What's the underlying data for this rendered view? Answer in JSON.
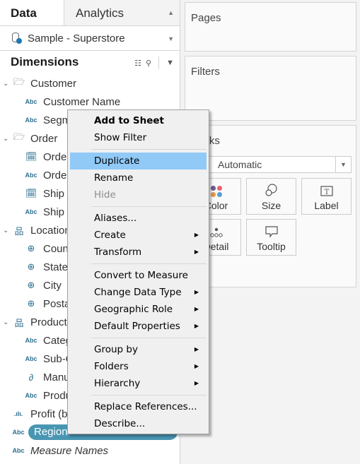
{
  "tabs": {
    "data": "Data",
    "analytics": "Analytics"
  },
  "data_source": "Sample - Superstore",
  "dimensions": {
    "title": "Dimensions",
    "tree": [
      {
        "type": "folder",
        "icon": "folder-icon",
        "label": "Customer"
      },
      {
        "type": "field",
        "icon": "abc-icon",
        "label": "Customer Name"
      },
      {
        "type": "field",
        "icon": "abc-icon",
        "label": "Segment"
      },
      {
        "type": "folder",
        "icon": "folder-icon",
        "label": "Order"
      },
      {
        "type": "field",
        "icon": "calendar-icon",
        "label": "Order Date"
      },
      {
        "type": "field",
        "icon": "abc-icon",
        "label": "Order ID"
      },
      {
        "type": "field",
        "icon": "calendar-icon",
        "label": "Ship Date"
      },
      {
        "type": "field",
        "icon": "abc-icon",
        "label": "Ship Mode"
      },
      {
        "type": "folder",
        "icon": "hierarchy-icon",
        "label": "Location"
      },
      {
        "type": "field",
        "icon": "globe-icon",
        "label": "Country"
      },
      {
        "type": "field",
        "icon": "globe-icon",
        "label": "State"
      },
      {
        "type": "field",
        "icon": "globe-icon",
        "label": "City"
      },
      {
        "type": "field",
        "icon": "globe-icon",
        "label": "Postal Code"
      },
      {
        "type": "folder",
        "icon": "hierarchy-icon",
        "label": "Product"
      },
      {
        "type": "field",
        "icon": "abc-icon",
        "label": "Category"
      },
      {
        "type": "field",
        "icon": "abc-icon",
        "label": "Sub-Category"
      },
      {
        "type": "field",
        "icon": "paperclip-icon",
        "label": "Manufacturer"
      },
      {
        "type": "field",
        "icon": "abc-icon",
        "label": "Product Name"
      },
      {
        "type": "top",
        "icon": "bin-icon",
        "label": "Profit (bin)"
      },
      {
        "type": "top",
        "icon": "abc-icon",
        "label": "Region",
        "selected": true
      },
      {
        "type": "top",
        "icon": "abc-icon",
        "label": "Measure Names",
        "italic": true
      }
    ]
  },
  "shelves": {
    "pages": "Pages",
    "filters": "Filters",
    "marks": "Marks"
  },
  "marks": {
    "type": "Automatic",
    "buttons": {
      "color": "Color",
      "size": "Size",
      "label": "Label",
      "detail": "Detail",
      "tooltip": "Tooltip"
    },
    "color_dots": [
      "#6b5b8c",
      "#e8636f",
      "#e39548",
      "#5b9bd1"
    ]
  },
  "context_menu": {
    "groups": [
      [
        {
          "label": "Add to Sheet",
          "bold": true
        },
        {
          "label": "Show Filter"
        }
      ],
      [
        {
          "label": "Duplicate",
          "highlighted": true
        },
        {
          "label": "Rename"
        },
        {
          "label": "Hide",
          "disabled": true
        }
      ],
      [
        {
          "label": "Aliases..."
        },
        {
          "label": "Create",
          "submenu": true
        },
        {
          "label": "Transform",
          "submenu": true
        }
      ],
      [
        {
          "label": "Convert to Measure"
        },
        {
          "label": "Change Data Type",
          "submenu": true
        },
        {
          "label": "Geographic Role",
          "submenu": true
        },
        {
          "label": "Default Properties",
          "submenu": true
        }
      ],
      [
        {
          "label": "Group by",
          "submenu": true
        },
        {
          "label": "Folders",
          "submenu": true
        },
        {
          "label": "Hierarchy",
          "submenu": true
        }
      ],
      [
        {
          "label": "Replace References..."
        },
        {
          "label": "Describe..."
        }
      ]
    ]
  },
  "colors": {
    "accent": "#4996b2",
    "menu_highlight": "#91c9f7",
    "field_icon": "#2e6f8e"
  }
}
